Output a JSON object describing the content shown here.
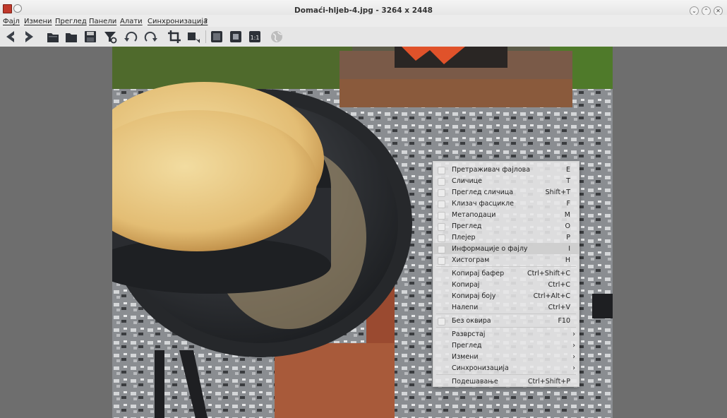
{
  "window": {
    "title": "Domaći-hljeb-4.jpg  - 3264 x 2448",
    "controls": [
      "⌄",
      "⌃",
      "✕"
    ]
  },
  "menubar": [
    "Фајл",
    "Измени",
    "Преглед",
    "Панели",
    "Алати",
    "Синхронизација",
    "?"
  ],
  "toolbar": {
    "icons": [
      "back-icon",
      "forward-icon",
      "open-file-icon",
      "open-folder-icon",
      "save-icon",
      "filter-icon",
      "rotate-left-icon",
      "rotate-right-icon",
      "crop-icon",
      "resize-icon",
      "fullscreen-icon",
      "fit-window-icon",
      "actual-size-icon",
      "globe-icon"
    ]
  },
  "context_menu": {
    "items": [
      {
        "label": "Претраживач фајлова",
        "shortcut": "E",
        "check": true
      },
      {
        "label": "Сличице",
        "shortcut": "T",
        "check": true
      },
      {
        "label": "Преглед сличица",
        "shortcut": "Shift+T",
        "check": true
      },
      {
        "label": "Клизач фасцикле",
        "shortcut": "F",
        "check": true
      },
      {
        "label": "Метаподаци",
        "shortcut": "M",
        "check": true
      },
      {
        "label": "Преглед",
        "shortcut": "O",
        "check": true
      },
      {
        "label": "Плејер",
        "shortcut": "P",
        "check": true
      },
      {
        "label": "Информације о фајлу",
        "shortcut": "I",
        "check": true,
        "highlighted": true
      },
      {
        "label": "Хистограм",
        "shortcut": "H",
        "check": true
      },
      {
        "separator": true
      },
      {
        "label": "Копирај бафер",
        "shortcut": "Ctrl+Shift+C",
        "check": false
      },
      {
        "label": "Копирај",
        "shortcut": "Ctrl+C",
        "check": false
      },
      {
        "label": "Копирај боју",
        "shortcut": "Ctrl+Alt+C",
        "check": false
      },
      {
        "label": "Налепи",
        "shortcut": "Ctrl+V",
        "check": false
      },
      {
        "separator": true
      },
      {
        "label": "Без оквира",
        "shortcut": "F10",
        "check": true
      },
      {
        "separator": true
      },
      {
        "label": "Разврстај",
        "submenu": true,
        "check": false
      },
      {
        "label": "Преглед",
        "submenu": true,
        "check": false
      },
      {
        "label": "Измени",
        "submenu": true,
        "check": false
      },
      {
        "label": "Синхронизација",
        "submenu": true,
        "check": false
      },
      {
        "separator": true
      },
      {
        "label": "Подешавање",
        "shortcut": "Ctrl+Shift+P",
        "check": false
      }
    ]
  },
  "colors": {
    "viewer_bg": "#6e6e6e",
    "titlebar_bg": "#ececec",
    "menu_highlight": "#cdcdcd"
  }
}
